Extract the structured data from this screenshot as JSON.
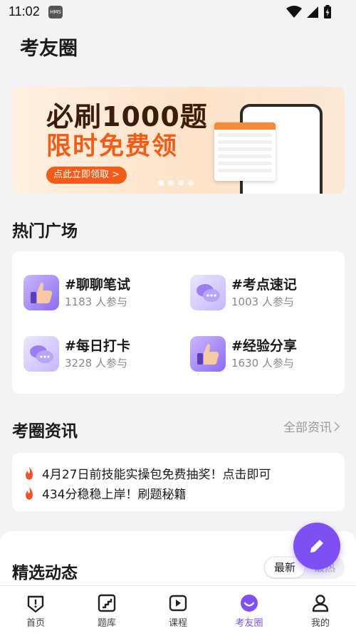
{
  "status": {
    "time": "11:02",
    "badge": "HMS"
  },
  "page": {
    "title": "考友圈"
  },
  "banner": {
    "headline": "必刷1000题",
    "subline": "限时免费领",
    "cta": "点此立即领取 >"
  },
  "hot": {
    "title": "热门广场",
    "topics": [
      {
        "name": "#聊聊笔试",
        "count": "1183 人参与",
        "icon": "thumbs-up-icon"
      },
      {
        "name": "#考点速记",
        "count": "1003 人参与",
        "icon": "chat-bubbles-icon"
      },
      {
        "name": "#每日打卡",
        "count": "3228 人参与",
        "icon": "chat-bubbles-icon"
      },
      {
        "name": "#经验分享",
        "count": "1630 人参与",
        "icon": "thumbs-up-icon"
      }
    ]
  },
  "news": {
    "title": "考圈资讯",
    "more": "全部资讯",
    "items": [
      "4月27日前技能实操包免费抽奖！点击即可",
      "434分稳稳上岸！刷题秘籍"
    ]
  },
  "feed": {
    "title": "精选动态",
    "sort_active": "最新",
    "sort_other": "最热"
  },
  "tabs": [
    {
      "label": "首页",
      "icon": "home-icon"
    },
    {
      "label": "题库",
      "icon": "question-bank-icon"
    },
    {
      "label": "课程",
      "icon": "course-play-icon"
    },
    {
      "label": "考友圈",
      "icon": "community-icon",
      "active": true
    },
    {
      "label": "我的",
      "icon": "profile-icon"
    }
  ],
  "colors": {
    "accent": "#7e4ff2",
    "banner_orange": "#f25c18",
    "fire": "#f2532c"
  }
}
